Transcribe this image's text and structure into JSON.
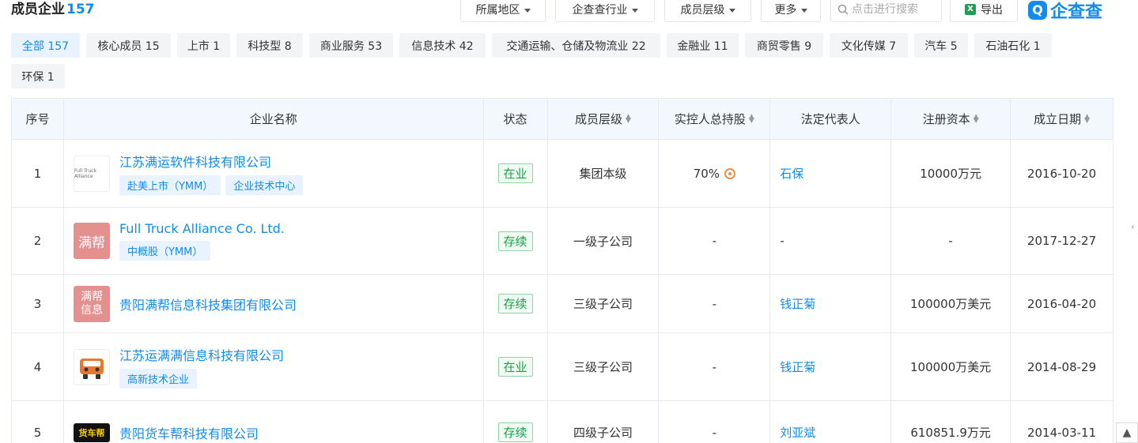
{
  "header": {
    "title": "成员企业",
    "count": "157",
    "filters": [
      {
        "label": "所属地区"
      },
      {
        "label": "企查查行业"
      },
      {
        "label": "成员层级"
      },
      {
        "label": "更多"
      }
    ],
    "search_placeholder": "点击进行搜索",
    "export_label": "导出",
    "logo_text": "企查查",
    "logo_mark": "Q"
  },
  "chips": [
    {
      "label": "全部 157",
      "active": true
    },
    {
      "label": "核心成员 15"
    },
    {
      "label": "上市 1"
    },
    {
      "label": "科技型 8"
    },
    {
      "label": "商业服务 53"
    },
    {
      "label": "信息技术 42"
    },
    {
      "label": "交通运输、仓储及物流业 22"
    },
    {
      "label": "金融业 11"
    },
    {
      "label": "商贸零售 9"
    },
    {
      "label": "文化传媒 7"
    },
    {
      "label": "汽车 5"
    },
    {
      "label": "石油石化 1"
    },
    {
      "label": "环保 1"
    }
  ],
  "table": {
    "headers": [
      "序号",
      "企业名称",
      "状态",
      "成员层级",
      "实控人总持股",
      "法定代表人",
      "注册资本",
      "成立日期"
    ],
    "rows": [
      {
        "idx": "1",
        "name": "江苏满运软件科技有限公司",
        "logo": "Full Truck Alliance",
        "tags": [
          "赴美上市（YMM）",
          "企业技术中心"
        ],
        "status": "在业",
        "level": "集团本级",
        "share": "70%",
        "rep": "石保",
        "capital": "10000万元",
        "date": "2016-10-20"
      },
      {
        "idx": "2",
        "name": "Full Truck Alliance Co. Ltd.",
        "logo": "满帮",
        "tags": [
          "中概股（YMM）"
        ],
        "status": "存续",
        "level": "一级子公司",
        "share": "-",
        "rep": "-",
        "capital": "-",
        "date": "2017-12-27"
      },
      {
        "idx": "3",
        "name": "贵阳满帮信息科技集团有限公司",
        "logo": "满帮信息",
        "tags": [],
        "status": "存续",
        "level": "三级子公司",
        "share": "-",
        "rep": "钱正菊",
        "capital": "100000万美元",
        "date": "2016-04-20"
      },
      {
        "idx": "4",
        "name": "江苏运满满信息科技有限公司",
        "logo": "truck",
        "tags": [
          "高新技术企业"
        ],
        "status": "在业",
        "level": "三级子公司",
        "share": "-",
        "rep": "钱正菊",
        "capital": "100000万美元",
        "date": "2014-08-29"
      },
      {
        "idx": "5",
        "name": "贵阳货车帮科技有限公司",
        "logo": "货车帮",
        "tags": [],
        "status": "存续",
        "level": "四级子公司",
        "share": "-",
        "rep": "刘亚斌",
        "capital": "610851.9万元",
        "date": "2014-03-11"
      }
    ]
  },
  "colors": {
    "accent": "#128bed",
    "status_green": "#18a04a",
    "header_bg": "#f2f8fe"
  },
  "icons": {
    "search": "search-icon",
    "export": "excel-icon",
    "share": "equity-chart-icon",
    "scroll_top": "back-to-top-icon"
  }
}
